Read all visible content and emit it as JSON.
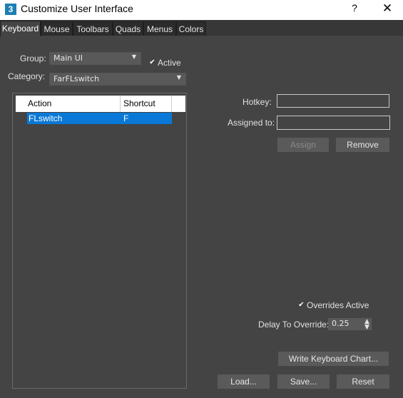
{
  "window": {
    "title": "Customize User Interface",
    "app_icon": "3",
    "help": "?",
    "close": "✕"
  },
  "tabs": [
    {
      "label": "Keyboard",
      "active": true
    },
    {
      "label": "Mouse"
    },
    {
      "label": "Toolbars"
    },
    {
      "label": "Quads"
    },
    {
      "label": "Menus"
    },
    {
      "label": "Colors"
    }
  ],
  "group": {
    "label": "Group:",
    "value": "Main UI"
  },
  "active_checkbox": {
    "label": "Active",
    "checked": true
  },
  "category": {
    "label": "Category:",
    "value": "FarFLswitch"
  },
  "list": {
    "columns": [
      "Action",
      "Shortcut"
    ],
    "rows": [
      {
        "action": "FLswitch",
        "shortcut": "F",
        "selected": true
      }
    ]
  },
  "hotkey": {
    "label": "Hotkey:",
    "value": ""
  },
  "assigned_to": {
    "label": "Assigned to:",
    "value": ""
  },
  "buttons": {
    "assign": "Assign",
    "remove": "Remove",
    "write_chart": "Write Keyboard Chart...",
    "load": "Load...",
    "save": "Save...",
    "reset": "Reset"
  },
  "overrides_active": {
    "label": "Overrides Active",
    "checked": true
  },
  "delay": {
    "label": "Delay To Override:",
    "value": "0.25"
  },
  "icons": {
    "dropdown": "chevron-down-icon",
    "check": "checkmark-icon",
    "spinner": "spinner-arrows-icon"
  },
  "colors": {
    "background": "#444444",
    "selection": "#0a78d7",
    "titlebar": "#ffffff"
  }
}
